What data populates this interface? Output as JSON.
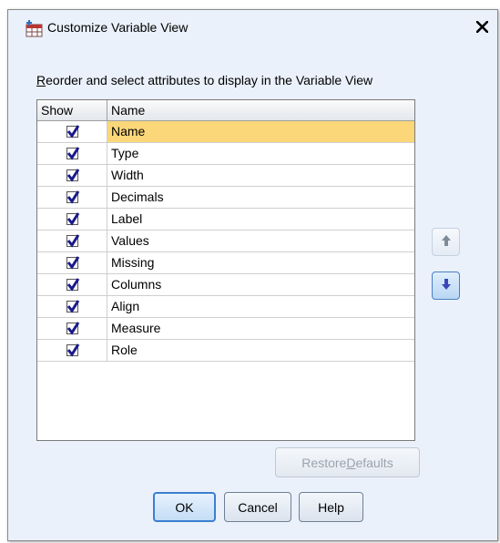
{
  "window": {
    "title": "Customize Variable View",
    "close_glyph": "✕"
  },
  "instructions": {
    "mnemonic": "R",
    "rest": "eorder and select attributes to display in the Variable View"
  },
  "grid": {
    "headers": {
      "show": "Show",
      "name": "Name"
    },
    "rows": [
      {
        "name": "Name",
        "checked": true,
        "selected": true
      },
      {
        "name": "Type",
        "checked": true
      },
      {
        "name": "Width",
        "checked": true
      },
      {
        "name": "Decimals",
        "checked": true
      },
      {
        "name": "Label",
        "checked": true
      },
      {
        "name": "Values",
        "checked": true
      },
      {
        "name": "Missing",
        "checked": true
      },
      {
        "name": "Columns",
        "checked": true
      },
      {
        "name": "Align",
        "checked": true
      },
      {
        "name": "Measure",
        "checked": true
      },
      {
        "name": "Role",
        "checked": true
      }
    ]
  },
  "side_buttons": {
    "up_icon": "arrow-up-icon",
    "down_icon": "arrow-down-icon"
  },
  "buttons": {
    "restore": {
      "before": "Restore ",
      "mnemonic": "D",
      "after": "efaults",
      "enabled": false
    },
    "ok": "OK",
    "cancel": "Cancel",
    "help": "Help"
  },
  "colors": {
    "dialog_bg": "#eaf1fb",
    "selected_row": "#fbd77a",
    "check_mark": "#1a1a8c",
    "arrow_up": "#7f8b99",
    "arrow_down": "#3b47b8"
  }
}
